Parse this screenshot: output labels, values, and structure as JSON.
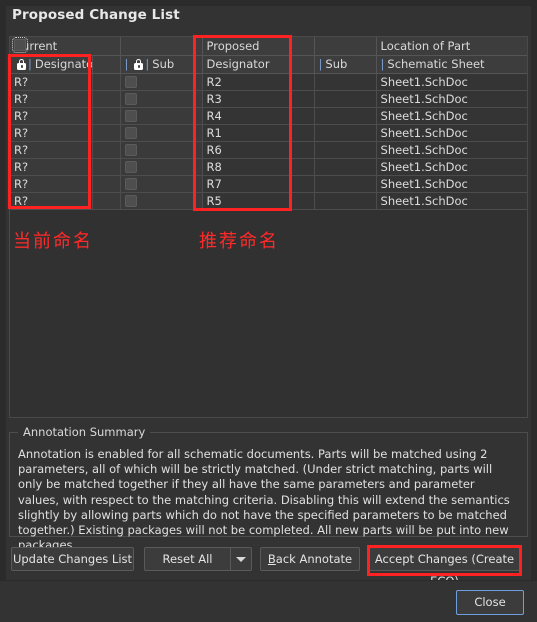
{
  "dialog": {
    "title": "Proposed Change List"
  },
  "table": {
    "group_headers": [
      {
        "label": "Current",
        "span": 2
      },
      {
        "label": "",
        "span": 1
      },
      {
        "label": "Proposed",
        "span": 1
      },
      {
        "label": "",
        "span": 1
      },
      {
        "label": "Location of Part",
        "span": 1
      }
    ],
    "column_headers": [
      {
        "label": "Designator",
        "lock": true,
        "sep": true
      },
      {
        "label": "",
        "lock": false,
        "sep": false
      },
      {
        "label": "Sub",
        "lock": true,
        "sep": true
      },
      {
        "label": "Designator",
        "lock": false,
        "sep": false
      },
      {
        "label": "Sub",
        "lock": false,
        "sep": true
      },
      {
        "label": "Schematic Sheet",
        "lock": false,
        "sep": false
      }
    ],
    "rows": [
      {
        "current_designator": "R?",
        "current_sub": "",
        "proposed_designator": "R2",
        "proposed_sub": "",
        "location": "Sheet1.SchDoc",
        "checkbox_focused": true
      },
      {
        "current_designator": "R?",
        "current_sub": "",
        "proposed_designator": "R3",
        "proposed_sub": "",
        "location": "Sheet1.SchDoc",
        "checkbox_focused": false
      },
      {
        "current_designator": "R?",
        "current_sub": "",
        "proposed_designator": "R4",
        "proposed_sub": "",
        "location": "Sheet1.SchDoc",
        "checkbox_focused": false
      },
      {
        "current_designator": "R?",
        "current_sub": "",
        "proposed_designator": "R1",
        "proposed_sub": "",
        "location": "Sheet1.SchDoc",
        "checkbox_focused": false
      },
      {
        "current_designator": "R?",
        "current_sub": "",
        "proposed_designator": "R6",
        "proposed_sub": "",
        "location": "Sheet1.SchDoc",
        "checkbox_focused": false
      },
      {
        "current_designator": "R?",
        "current_sub": "",
        "proposed_designator": "R8",
        "proposed_sub": "",
        "location": "Sheet1.SchDoc",
        "checkbox_focused": false
      },
      {
        "current_designator": "R?",
        "current_sub": "",
        "proposed_designator": "R7",
        "proposed_sub": "",
        "location": "Sheet1.SchDoc",
        "checkbox_focused": false
      },
      {
        "current_designator": "R?",
        "current_sub": "",
        "proposed_designator": "R5",
        "proposed_sub": "",
        "location": "Sheet1.SchDoc",
        "checkbox_focused": false
      }
    ]
  },
  "annotations": {
    "color": "#ff2222",
    "current_label": "当前命名",
    "proposed_label": "推荐命名"
  },
  "summary": {
    "legend": "Annotation Summary",
    "text": "Annotation is enabled for all schematic documents. Parts will be matched using 2 parameters, all of which will be strictly matched. (Under strict matching, parts will only be matched together if they all have the same parameters and parameter values, with respect to the matching criteria. Disabling this will extend the semantics slightly by allowing parts which do not have the specified parameters to be matched together.) Existing packages will not be completed. All new parts will be put into new packages."
  },
  "buttons": {
    "update_changes_list": "Update Changes List",
    "reset_all": "Reset All",
    "reset_all_arrow": "chevron-down-icon",
    "back_annotate_prefix": "",
    "back_annotate_accel": "B",
    "back_annotate_rest": "ack Annotate",
    "accept_changes": "Accept Changes (Create ECO)",
    "close": "Close"
  }
}
